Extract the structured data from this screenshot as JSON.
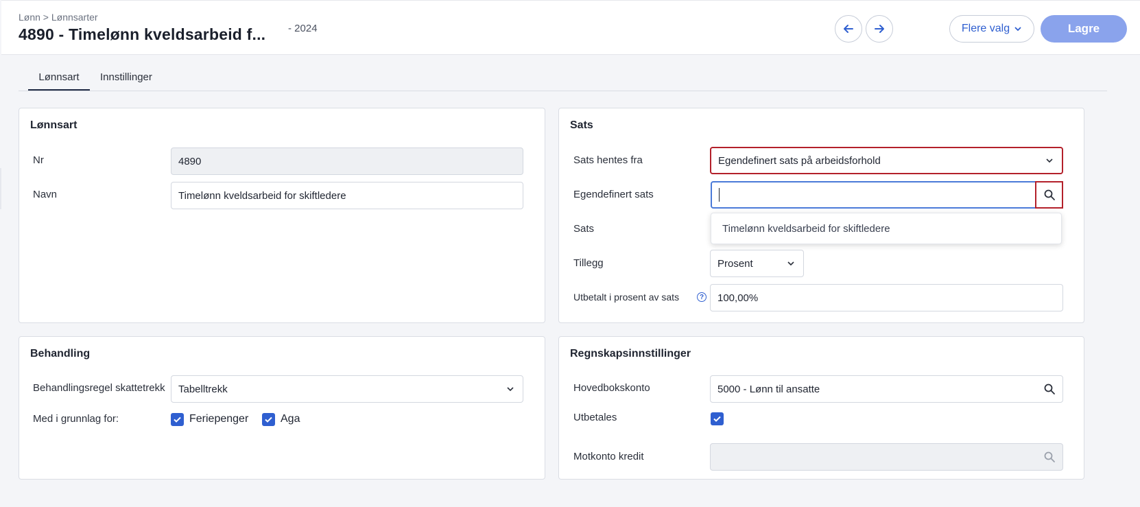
{
  "header": {
    "breadcrumb": "Lønn > Lønnsarter",
    "title": "4890 - Timelønn kveldsarbeid f...",
    "year": "- 2024",
    "more_label": "Flere valg",
    "save_label": "Lagre"
  },
  "tabs": [
    {
      "label": "Lønnsart",
      "active": true
    },
    {
      "label": "Innstillinger",
      "active": false
    }
  ],
  "lonnsart": {
    "title": "Lønnsart",
    "nr_label": "Nr",
    "nr_value": "4890",
    "navn_label": "Navn",
    "navn_value": "Timelønn kveldsarbeid for skiftledere"
  },
  "sats": {
    "title": "Sats",
    "hentes_label": "Sats hentes fra",
    "hentes_value": "Egendefinert sats på arbeidsforhold",
    "egendef_label": "Egendefinert sats",
    "egendef_value": "",
    "dropdown_option": "Timelønn kveldsarbeid for skiftledere",
    "sats_label": "Sats",
    "tillegg_label": "Tillegg",
    "tillegg_value": "Prosent",
    "utbetalt_label": "Utbetalt i prosent av sats",
    "utbetalt_value": "100,00%"
  },
  "behandling": {
    "title": "Behandling",
    "regel_label": "Behandlingsregel skattetrekk",
    "regel_value": "Tabelltrekk",
    "grunnlag_label": "Med i grunnlag for:",
    "feriepenger_label": "Feriepenger",
    "feriepenger_checked": true,
    "aga_label": "Aga",
    "aga_checked": true
  },
  "regnskap": {
    "title": "Regnskapsinnstillinger",
    "hovedbok_label": "Hovedbokskonto",
    "hovedbok_value": "5000 - Lønn til ansatte",
    "utbetales_label": "Utbetales",
    "utbetales_checked": true,
    "motkonto_label": "Motkonto kredit",
    "motkonto_value": ""
  },
  "colors": {
    "accent": "#2f5fd0",
    "save_button": "#8aa3ec",
    "error_outline": "#b3202a"
  }
}
